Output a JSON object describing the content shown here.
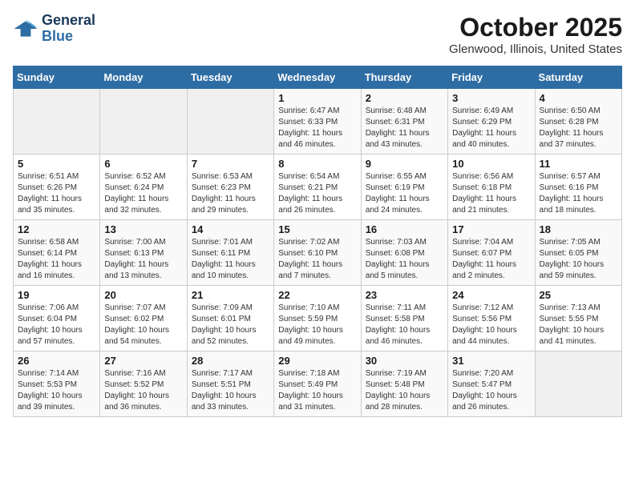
{
  "header": {
    "logo_line1": "General",
    "logo_line2": "Blue",
    "month": "October 2025",
    "location": "Glenwood, Illinois, United States"
  },
  "weekdays": [
    "Sunday",
    "Monday",
    "Tuesday",
    "Wednesday",
    "Thursday",
    "Friday",
    "Saturday"
  ],
  "weeks": [
    [
      {
        "day": "",
        "info": ""
      },
      {
        "day": "",
        "info": ""
      },
      {
        "day": "",
        "info": ""
      },
      {
        "day": "1",
        "info": "Sunrise: 6:47 AM\nSunset: 6:33 PM\nDaylight: 11 hours and 46 minutes."
      },
      {
        "day": "2",
        "info": "Sunrise: 6:48 AM\nSunset: 6:31 PM\nDaylight: 11 hours and 43 minutes."
      },
      {
        "day": "3",
        "info": "Sunrise: 6:49 AM\nSunset: 6:29 PM\nDaylight: 11 hours and 40 minutes."
      },
      {
        "day": "4",
        "info": "Sunrise: 6:50 AM\nSunset: 6:28 PM\nDaylight: 11 hours and 37 minutes."
      }
    ],
    [
      {
        "day": "5",
        "info": "Sunrise: 6:51 AM\nSunset: 6:26 PM\nDaylight: 11 hours and 35 minutes."
      },
      {
        "day": "6",
        "info": "Sunrise: 6:52 AM\nSunset: 6:24 PM\nDaylight: 11 hours and 32 minutes."
      },
      {
        "day": "7",
        "info": "Sunrise: 6:53 AM\nSunset: 6:23 PM\nDaylight: 11 hours and 29 minutes."
      },
      {
        "day": "8",
        "info": "Sunrise: 6:54 AM\nSunset: 6:21 PM\nDaylight: 11 hours and 26 minutes."
      },
      {
        "day": "9",
        "info": "Sunrise: 6:55 AM\nSunset: 6:19 PM\nDaylight: 11 hours and 24 minutes."
      },
      {
        "day": "10",
        "info": "Sunrise: 6:56 AM\nSunset: 6:18 PM\nDaylight: 11 hours and 21 minutes."
      },
      {
        "day": "11",
        "info": "Sunrise: 6:57 AM\nSunset: 6:16 PM\nDaylight: 11 hours and 18 minutes."
      }
    ],
    [
      {
        "day": "12",
        "info": "Sunrise: 6:58 AM\nSunset: 6:14 PM\nDaylight: 11 hours and 16 minutes."
      },
      {
        "day": "13",
        "info": "Sunrise: 7:00 AM\nSunset: 6:13 PM\nDaylight: 11 hours and 13 minutes."
      },
      {
        "day": "14",
        "info": "Sunrise: 7:01 AM\nSunset: 6:11 PM\nDaylight: 11 hours and 10 minutes."
      },
      {
        "day": "15",
        "info": "Sunrise: 7:02 AM\nSunset: 6:10 PM\nDaylight: 11 hours and 7 minutes."
      },
      {
        "day": "16",
        "info": "Sunrise: 7:03 AM\nSunset: 6:08 PM\nDaylight: 11 hours and 5 minutes."
      },
      {
        "day": "17",
        "info": "Sunrise: 7:04 AM\nSunset: 6:07 PM\nDaylight: 11 hours and 2 minutes."
      },
      {
        "day": "18",
        "info": "Sunrise: 7:05 AM\nSunset: 6:05 PM\nDaylight: 10 hours and 59 minutes."
      }
    ],
    [
      {
        "day": "19",
        "info": "Sunrise: 7:06 AM\nSunset: 6:04 PM\nDaylight: 10 hours and 57 minutes."
      },
      {
        "day": "20",
        "info": "Sunrise: 7:07 AM\nSunset: 6:02 PM\nDaylight: 10 hours and 54 minutes."
      },
      {
        "day": "21",
        "info": "Sunrise: 7:09 AM\nSunset: 6:01 PM\nDaylight: 10 hours and 52 minutes."
      },
      {
        "day": "22",
        "info": "Sunrise: 7:10 AM\nSunset: 5:59 PM\nDaylight: 10 hours and 49 minutes."
      },
      {
        "day": "23",
        "info": "Sunrise: 7:11 AM\nSunset: 5:58 PM\nDaylight: 10 hours and 46 minutes."
      },
      {
        "day": "24",
        "info": "Sunrise: 7:12 AM\nSunset: 5:56 PM\nDaylight: 10 hours and 44 minutes."
      },
      {
        "day": "25",
        "info": "Sunrise: 7:13 AM\nSunset: 5:55 PM\nDaylight: 10 hours and 41 minutes."
      }
    ],
    [
      {
        "day": "26",
        "info": "Sunrise: 7:14 AM\nSunset: 5:53 PM\nDaylight: 10 hours and 39 minutes."
      },
      {
        "day": "27",
        "info": "Sunrise: 7:16 AM\nSunset: 5:52 PM\nDaylight: 10 hours and 36 minutes."
      },
      {
        "day": "28",
        "info": "Sunrise: 7:17 AM\nSunset: 5:51 PM\nDaylight: 10 hours and 33 minutes."
      },
      {
        "day": "29",
        "info": "Sunrise: 7:18 AM\nSunset: 5:49 PM\nDaylight: 10 hours and 31 minutes."
      },
      {
        "day": "30",
        "info": "Sunrise: 7:19 AM\nSunset: 5:48 PM\nDaylight: 10 hours and 28 minutes."
      },
      {
        "day": "31",
        "info": "Sunrise: 7:20 AM\nSunset: 5:47 PM\nDaylight: 10 hours and 26 minutes."
      },
      {
        "day": "",
        "info": ""
      }
    ]
  ]
}
